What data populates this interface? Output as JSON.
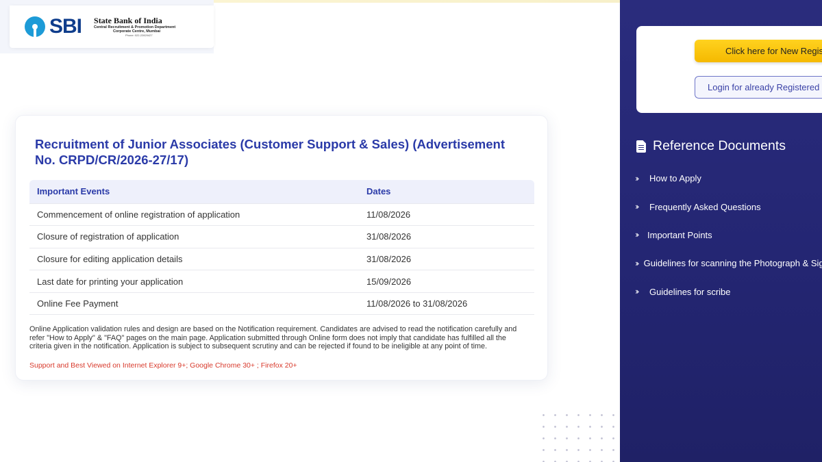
{
  "header": {
    "logo_text": "SBI",
    "bank_name": "State Bank of India",
    "department": "Central Recruitment & Promotion Department",
    "centre": "Corporate Centre, Mumbai",
    "phone": "Phone: 022-22820427"
  },
  "main": {
    "title": "Recruitment of Junior Associates (Customer Support & Sales) (Advertisement No. CRPD/CR/2026-27/17)",
    "table": {
      "headers": [
        "Important Events",
        "Dates"
      ],
      "rows": [
        [
          "Commencement of online registration of application",
          "11/08/2026"
        ],
        [
          "Closure of registration of application",
          "31/08/2026"
        ],
        [
          "Closure for editing application details",
          "31/08/2026"
        ],
        [
          "Last date for printing your application",
          "15/09/2026"
        ],
        [
          "Online Fee Payment",
          "11/08/2026 to 31/08/2026"
        ]
      ]
    },
    "note": "Online Application validation rules and design are based on the Notification requirement. Candidates are advised to read the notification carefully and refer \"How to Apply\" & \"FAQ\" pages on the main page. Application submitted through Online form does not imply that candidate has fulfilled all the criteria given in the notification. Application is subject to subsequent scrutiny and can be rejected if found to be ineligible at any point of time.",
    "support": "Support and Best Viewed on Internet Explorer 9+; Google Chrome 30+ ; Firefox 20+"
  },
  "sidebar": {
    "new_registration_label": "Click here for New Registration",
    "login_label": "Login for already Registered Candidates",
    "reference_title": "Reference Documents",
    "links": [
      "How to Apply",
      "Frequently Asked Questions",
      "Important Points",
      "Guidelines for scanning the Photograph & Signature",
      "Guidelines for scribe"
    ]
  },
  "colors": {
    "brand_blue": "#2a3aa8",
    "sidebar_bg": "#2a2c7d",
    "accent_yellow": "#f5b900",
    "support_red": "#d8392b"
  },
  "icons": {
    "document": "document-icon",
    "chevron": "double-chevron-right-icon"
  }
}
